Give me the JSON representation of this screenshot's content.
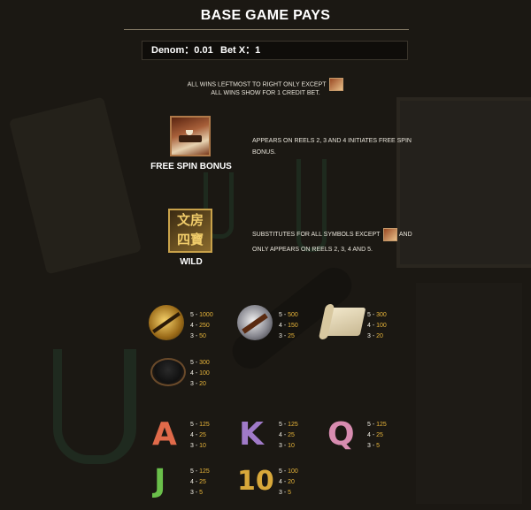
{
  "header": {
    "title": "BASE GAME PAYS"
  },
  "info": {
    "denom_label": "Denom",
    "denom_value": "0.01",
    "bet_label": "Bet X",
    "bet_value": "1"
  },
  "notes": {
    "line1": "ALL WINS LEFTMOST TO RIGHT ONLY EXCEPT",
    "line2": "ALL WINS SHOW FOR 1 CREDIT BET."
  },
  "free_spin": {
    "label": "FREE SPIN BONUS",
    "desc": "APPEARS ON REELS 2, 3 AND 4 INITIATES FREE SPIN BONUS."
  },
  "wild": {
    "label": "WILD",
    "chars": [
      "文",
      "房",
      "四",
      "寶"
    ],
    "desc_part1": "SUBSTITUTES FOR ALL SYMBOLS EXCEPT",
    "desc_part2": "AND",
    "desc_part3": "ONLY APPEARS ON REELS 2, 3, 4 AND 5."
  },
  "paytable": [
    {
      "symbol": "gold-brush-icon",
      "pays": [
        [
          "5",
          "1000"
        ],
        [
          "4",
          "250"
        ],
        [
          "3",
          "50"
        ]
      ]
    },
    {
      "symbol": "silver-brush-icon",
      "pays": [
        [
          "5",
          "500"
        ],
        [
          "4",
          "150"
        ],
        [
          "3",
          "25"
        ]
      ]
    },
    {
      "symbol": "paper-scroll-icon",
      "pays": [
        [
          "5",
          "300"
        ],
        [
          "4",
          "100"
        ],
        [
          "3",
          "20"
        ]
      ]
    },
    {
      "symbol": "ink-stone-icon",
      "pays": [
        [
          "5",
          "300"
        ],
        [
          "4",
          "100"
        ],
        [
          "3",
          "20"
        ]
      ]
    },
    {
      "symbol": "A",
      "pays": [
        [
          "5",
          "125"
        ],
        [
          "4",
          "25"
        ],
        [
          "3",
          "10"
        ]
      ]
    },
    {
      "symbol": "K",
      "pays": [
        [
          "5",
          "125"
        ],
        [
          "4",
          "25"
        ],
        [
          "3",
          "10"
        ]
      ]
    },
    {
      "symbol": "Q",
      "pays": [
        [
          "5",
          "125"
        ],
        [
          "4",
          "25"
        ],
        [
          "3",
          "5"
        ]
      ]
    },
    {
      "symbol": "J",
      "pays": [
        [
          "5",
          "125"
        ],
        [
          "4",
          "25"
        ],
        [
          "3",
          "5"
        ]
      ]
    },
    {
      "symbol": "10",
      "pays": [
        [
          "5",
          "100"
        ],
        [
          "4",
          "20"
        ],
        [
          "3",
          "5"
        ]
      ]
    }
  ],
  "colors": {
    "background": "#1b1813",
    "pay_number": "#e8b53a"
  }
}
